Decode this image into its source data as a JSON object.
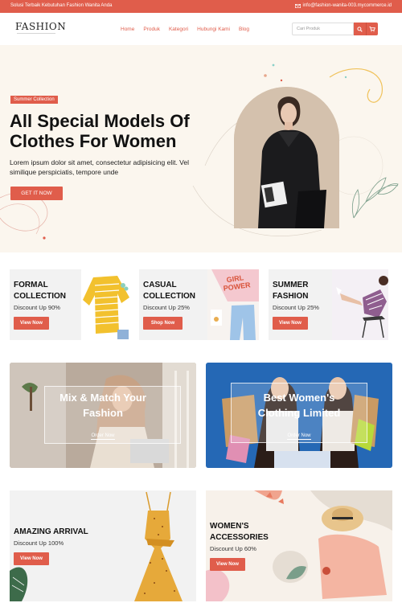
{
  "topbar": {
    "tagline": "Solusi Terbaik Kebutuhan Fashion Wanita Anda",
    "email": "info@fashion-wanita-003.mycommerce.id",
    "icons": {
      "email": "envelope-icon"
    }
  },
  "header": {
    "logo": "FASHION",
    "nav": [
      "Home",
      "Produk",
      "Kategori",
      "Hubungi Kami",
      "Blog"
    ],
    "search_placeholder": "Cari Produk",
    "icons": {
      "search": "search-icon",
      "cart": "cart-icon"
    }
  },
  "hero": {
    "badge": "Summer Collection",
    "title_line1": "All Special Models Of",
    "title_line2": "Clothes For Women",
    "description": "Lorem ipsum dolor sit amet, consectetur adipisicing elit. Vel similique perspiciatis, tempore unde",
    "cta": "GET IT NOW"
  },
  "categories": [
    {
      "title1": "FORMAL",
      "title2": "COLLECTION",
      "subtitle": "Discount Up 90%",
      "button": "View Now"
    },
    {
      "title1": "CASUAL",
      "title2": "COLLECTION",
      "subtitle": "Discount Up 25%",
      "button": "Shop Now"
    },
    {
      "title1": "SUMMER",
      "title2": "FASHION",
      "subtitle": "Discount Up 25%",
      "button": "View Now"
    }
  ],
  "promos": [
    {
      "title1": "Mix & Match Your",
      "title2": "Fashion",
      "link": "Order Now"
    },
    {
      "title1": "Best Women's",
      "title2": "Clothing Limited",
      "link": "Order Now"
    }
  ],
  "arrivals": [
    {
      "title": "AMAZING ARRIVAL",
      "subtitle": "Discount Up 100%",
      "button": "View Now"
    },
    {
      "title1": "WOMEN'S",
      "title2": "ACCESSORIES",
      "subtitle": "Discount Up 60%",
      "button": "View Now"
    }
  ],
  "colors": {
    "accent": "#e05d4b",
    "hero_bg": "#fbf6ee",
    "card_bg": "#f2f2f2"
  }
}
